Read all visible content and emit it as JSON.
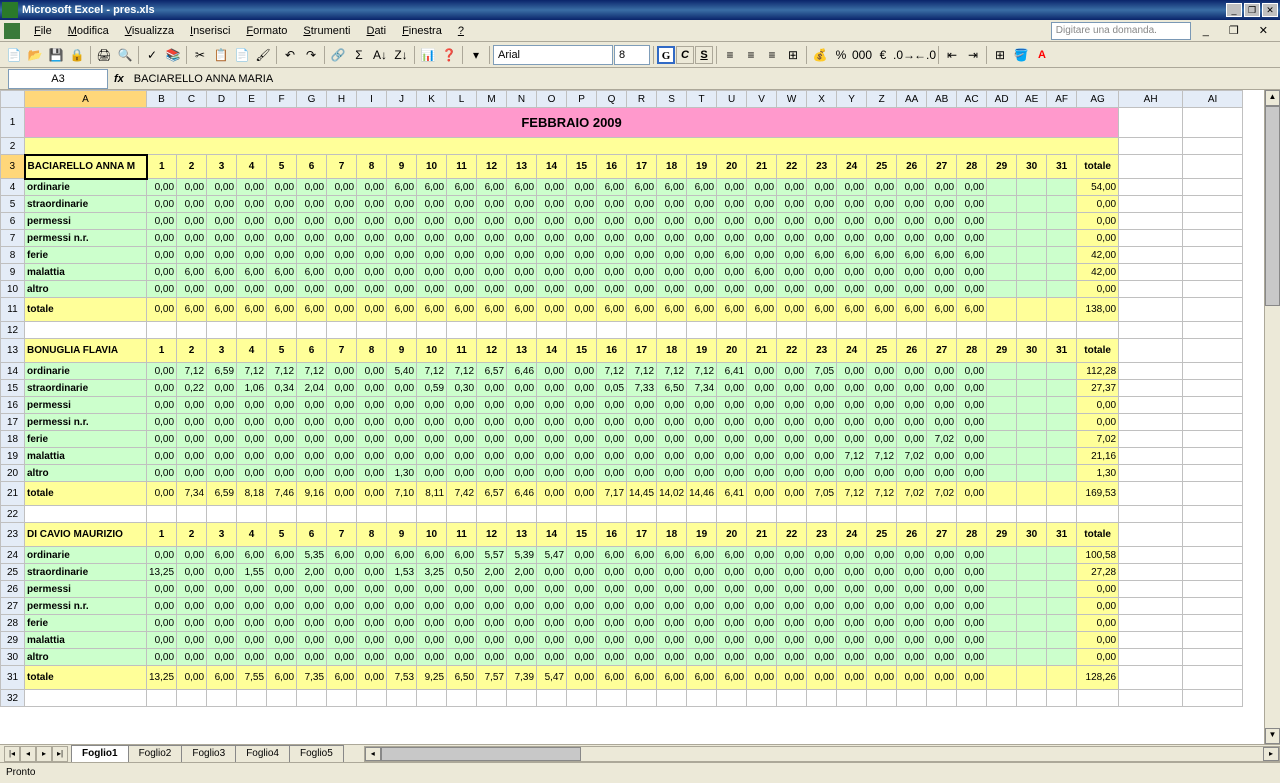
{
  "app": {
    "title": "Microsoft Excel - pres.xls"
  },
  "menu": {
    "items": [
      "File",
      "Modifica",
      "Visualizza",
      "Inserisci",
      "Formato",
      "Strumenti",
      "Dati",
      "Finestra",
      "?"
    ],
    "question": "Digitare una domanda."
  },
  "toolbar": {
    "font": "Arial",
    "size": "8"
  },
  "namebox": {
    "ref": "A3",
    "formula": "BACIARELLO ANNA MARIA"
  },
  "columns": [
    "A",
    "B",
    "C",
    "D",
    "E",
    "F",
    "G",
    "H",
    "I",
    "J",
    "K",
    "L",
    "M",
    "N",
    "O",
    "P",
    "Q",
    "R",
    "S",
    "T",
    "U",
    "V",
    "W",
    "X",
    "Y",
    "Z",
    "AA",
    "AB",
    "AC",
    "AD",
    "AE",
    "AF",
    "AG",
    "AH",
    "AI"
  ],
  "monthTitle": "FEBBRAIO 2009",
  "days": [
    "1",
    "2",
    "3",
    "4",
    "5",
    "6",
    "7",
    "8",
    "9",
    "10",
    "11",
    "12",
    "13",
    "14",
    "15",
    "16",
    "17",
    "18",
    "19",
    "20",
    "21",
    "22",
    "23",
    "24",
    "25",
    "26",
    "27",
    "28",
    "29",
    "30",
    "31"
  ],
  "totLabel": "totale",
  "rowLabels": {
    "ord": "ordinarie",
    "str": "straordinarie",
    "per": "permessi",
    "pnr": "permessi n.r.",
    "fer": "ferie",
    "mal": "malattia",
    "alt": "altro",
    "tot": "totale"
  },
  "chart_data": {
    "type": "table",
    "title": "FEBBRAIO 2009",
    "categories": [
      "1",
      "2",
      "3",
      "4",
      "5",
      "6",
      "7",
      "8",
      "9",
      "10",
      "11",
      "12",
      "13",
      "14",
      "15",
      "16",
      "17",
      "18",
      "19",
      "20",
      "21",
      "22",
      "23",
      "24",
      "25",
      "26",
      "27",
      "28"
    ],
    "persons": [
      {
        "name": "BACIARELLO ANNA M",
        "rows": {
          "ordinarie": {
            "v": [
              "0,00",
              "0,00",
              "0,00",
              "0,00",
              "0,00",
              "0,00",
              "0,00",
              "0,00",
              "6,00",
              "6,00",
              "6,00",
              "6,00",
              "6,00",
              "0,00",
              "0,00",
              "6,00",
              "6,00",
              "6,00",
              "6,00",
              "0,00",
              "0,00",
              "0,00",
              "0,00",
              "0,00",
              "0,00",
              "0,00",
              "0,00",
              "0,00"
            ],
            "t": "54,00"
          },
          "straordinarie": {
            "v": [
              "0,00",
              "0,00",
              "0,00",
              "0,00",
              "0,00",
              "0,00",
              "0,00",
              "0,00",
              "0,00",
              "0,00",
              "0,00",
              "0,00",
              "0,00",
              "0,00",
              "0,00",
              "0,00",
              "0,00",
              "0,00",
              "0,00",
              "0,00",
              "0,00",
              "0,00",
              "0,00",
              "0,00",
              "0,00",
              "0,00",
              "0,00",
              "0,00"
            ],
            "t": "0,00"
          },
          "permessi": {
            "v": [
              "0,00",
              "0,00",
              "0,00",
              "0,00",
              "0,00",
              "0,00",
              "0,00",
              "0,00",
              "0,00",
              "0,00",
              "0,00",
              "0,00",
              "0,00",
              "0,00",
              "0,00",
              "0,00",
              "0,00",
              "0,00",
              "0,00",
              "0,00",
              "0,00",
              "0,00",
              "0,00",
              "0,00",
              "0,00",
              "0,00",
              "0,00",
              "0,00"
            ],
            "t": "0,00"
          },
          "permessi n.r.": {
            "v": [
              "0,00",
              "0,00",
              "0,00",
              "0,00",
              "0,00",
              "0,00",
              "0,00",
              "0,00",
              "0,00",
              "0,00",
              "0,00",
              "0,00",
              "0,00",
              "0,00",
              "0,00",
              "0,00",
              "0,00",
              "0,00",
              "0,00",
              "0,00",
              "0,00",
              "0,00",
              "0,00",
              "0,00",
              "0,00",
              "0,00",
              "0,00",
              "0,00"
            ],
            "t": "0,00"
          },
          "ferie": {
            "v": [
              "0,00",
              "0,00",
              "0,00",
              "0,00",
              "0,00",
              "0,00",
              "0,00",
              "0,00",
              "0,00",
              "0,00",
              "0,00",
              "0,00",
              "0,00",
              "0,00",
              "0,00",
              "0,00",
              "0,00",
              "0,00",
              "0,00",
              "6,00",
              "0,00",
              "0,00",
              "6,00",
              "6,00",
              "6,00",
              "6,00",
              "6,00",
              "6,00"
            ],
            "t": "42,00"
          },
          "malattia": {
            "v": [
              "0,00",
              "6,00",
              "6,00",
              "6,00",
              "6,00",
              "6,00",
              "0,00",
              "0,00",
              "0,00",
              "0,00",
              "0,00",
              "0,00",
              "0,00",
              "0,00",
              "0,00",
              "0,00",
              "0,00",
              "0,00",
              "0,00",
              "0,00",
              "6,00",
              "0,00",
              "0,00",
              "0,00",
              "0,00",
              "0,00",
              "0,00",
              "0,00"
            ],
            "t": "42,00"
          },
          "altro": {
            "v": [
              "0,00",
              "0,00",
              "0,00",
              "0,00",
              "0,00",
              "0,00",
              "0,00",
              "0,00",
              "0,00",
              "0,00",
              "0,00",
              "0,00",
              "0,00",
              "0,00",
              "0,00",
              "0,00",
              "0,00",
              "0,00",
              "0,00",
              "0,00",
              "0,00",
              "0,00",
              "0,00",
              "0,00",
              "0,00",
              "0,00",
              "0,00",
              "0,00"
            ],
            "t": "0,00"
          },
          "totale": {
            "v": [
              "0,00",
              "6,00",
              "6,00",
              "6,00",
              "6,00",
              "6,00",
              "0,00",
              "0,00",
              "6,00",
              "6,00",
              "6,00",
              "6,00",
              "6,00",
              "0,00",
              "0,00",
              "6,00",
              "6,00",
              "6,00",
              "6,00",
              "6,00",
              "6,00",
              "0,00",
              "6,00",
              "6,00",
              "6,00",
              "6,00",
              "6,00",
              "6,00"
            ],
            "t": "138,00"
          }
        }
      },
      {
        "name": "BONUGLIA FLAVIA",
        "rows": {
          "ordinarie": {
            "v": [
              "0,00",
              "7,12",
              "6,59",
              "7,12",
              "7,12",
              "7,12",
              "0,00",
              "0,00",
              "5,40",
              "7,12",
              "7,12",
              "6,57",
              "6,46",
              "0,00",
              "0,00",
              "7,12",
              "7,12",
              "7,12",
              "7,12",
              "6,41",
              "0,00",
              "0,00",
              "7,05",
              "0,00",
              "0,00",
              "0,00",
              "0,00",
              "0,00"
            ],
            "t": "112,28"
          },
          "straordinarie": {
            "v": [
              "0,00",
              "0,22",
              "0,00",
              "1,06",
              "0,34",
              "2,04",
              "0,00",
              "0,00",
              "0,00",
              "0,59",
              "0,30",
              "0,00",
              "0,00",
              "0,00",
              "0,00",
              "0,05",
              "7,33",
              "6,50",
              "7,34",
              "0,00",
              "0,00",
              "0,00",
              "0,00",
              "0,00",
              "0,00",
              "0,00",
              "0,00",
              "0,00"
            ],
            "t": "27,37"
          },
          "permessi": {
            "v": [
              "0,00",
              "0,00",
              "0,00",
              "0,00",
              "0,00",
              "0,00",
              "0,00",
              "0,00",
              "0,00",
              "0,00",
              "0,00",
              "0,00",
              "0,00",
              "0,00",
              "0,00",
              "0,00",
              "0,00",
              "0,00",
              "0,00",
              "0,00",
              "0,00",
              "0,00",
              "0,00",
              "0,00",
              "0,00",
              "0,00",
              "0,00",
              "0,00"
            ],
            "t": "0,00"
          },
          "permessi n.r.": {
            "v": [
              "0,00",
              "0,00",
              "0,00",
              "0,00",
              "0,00",
              "0,00",
              "0,00",
              "0,00",
              "0,00",
              "0,00",
              "0,00",
              "0,00",
              "0,00",
              "0,00",
              "0,00",
              "0,00",
              "0,00",
              "0,00",
              "0,00",
              "0,00",
              "0,00",
              "0,00",
              "0,00",
              "0,00",
              "0,00",
              "0,00",
              "0,00",
              "0,00"
            ],
            "t": "0,00"
          },
          "ferie": {
            "v": [
              "0,00",
              "0,00",
              "0,00",
              "0,00",
              "0,00",
              "0,00",
              "0,00",
              "0,00",
              "0,00",
              "0,00",
              "0,00",
              "0,00",
              "0,00",
              "0,00",
              "0,00",
              "0,00",
              "0,00",
              "0,00",
              "0,00",
              "0,00",
              "0,00",
              "0,00",
              "0,00",
              "0,00",
              "0,00",
              "0,00",
              "7,02",
              "0,00"
            ],
            "t": "7,02"
          },
          "malattia": {
            "v": [
              "0,00",
              "0,00",
              "0,00",
              "0,00",
              "0,00",
              "0,00",
              "0,00",
              "0,00",
              "0,00",
              "0,00",
              "0,00",
              "0,00",
              "0,00",
              "0,00",
              "0,00",
              "0,00",
              "0,00",
              "0,00",
              "0,00",
              "0,00",
              "0,00",
              "0,00",
              "0,00",
              "7,12",
              "7,12",
              "7,02",
              "0,00",
              "0,00"
            ],
            "t": "21,16"
          },
          "altro": {
            "v": [
              "0,00",
              "0,00",
              "0,00",
              "0,00",
              "0,00",
              "0,00",
              "0,00",
              "0,00",
              "1,30",
              "0,00",
              "0,00",
              "0,00",
              "0,00",
              "0,00",
              "0,00",
              "0,00",
              "0,00",
              "0,00",
              "0,00",
              "0,00",
              "0,00",
              "0,00",
              "0,00",
              "0,00",
              "0,00",
              "0,00",
              "0,00",
              "0,00"
            ],
            "t": "1,30"
          },
          "totale": {
            "v": [
              "0,00",
              "7,34",
              "6,59",
              "8,18",
              "7,46",
              "9,16",
              "0,00",
              "0,00",
              "7,10",
              "8,11",
              "7,42",
              "6,57",
              "6,46",
              "0,00",
              "0,00",
              "7,17",
              "14,45",
              "14,02",
              "14,46",
              "6,41",
              "0,00",
              "0,00",
              "7,05",
              "7,12",
              "7,12",
              "7,02",
              "7,02",
              "0,00"
            ],
            "t": "169,53"
          }
        }
      },
      {
        "name": "DI CAVIO MAURIZIO",
        "rows": {
          "ordinarie": {
            "v": [
              "0,00",
              "0,00",
              "6,00",
              "6,00",
              "6,00",
              "5,35",
              "6,00",
              "0,00",
              "6,00",
              "6,00",
              "6,00",
              "5,57",
              "5,39",
              "5,47",
              "0,00",
              "6,00",
              "6,00",
              "6,00",
              "6,00",
              "6,00",
              "0,00",
              "0,00",
              "0,00",
              "0,00",
              "0,00",
              "0,00",
              "0,00",
              "0,00"
            ],
            "t": "100,58"
          },
          "straordinarie": {
            "v": [
              "13,25",
              "0,00",
              "0,00",
              "1,55",
              "0,00",
              "2,00",
              "0,00",
              "0,00",
              "1,53",
              "3,25",
              "0,50",
              "2,00",
              "2,00",
              "0,00",
              "0,00",
              "0,00",
              "0,00",
              "0,00",
              "0,00",
              "0,00",
              "0,00",
              "0,00",
              "0,00",
              "0,00",
              "0,00",
              "0,00",
              "0,00",
              "0,00"
            ],
            "t": "27,28"
          },
          "permessi": {
            "v": [
              "0,00",
              "0,00",
              "0,00",
              "0,00",
              "0,00",
              "0,00",
              "0,00",
              "0,00",
              "0,00",
              "0,00",
              "0,00",
              "0,00",
              "0,00",
              "0,00",
              "0,00",
              "0,00",
              "0,00",
              "0,00",
              "0,00",
              "0,00",
              "0,00",
              "0,00",
              "0,00",
              "0,00",
              "0,00",
              "0,00",
              "0,00",
              "0,00"
            ],
            "t": "0,00"
          },
          "permessi n.r.": {
            "v": [
              "0,00",
              "0,00",
              "0,00",
              "0,00",
              "0,00",
              "0,00",
              "0,00",
              "0,00",
              "0,00",
              "0,00",
              "0,00",
              "0,00",
              "0,00",
              "0,00",
              "0,00",
              "0,00",
              "0,00",
              "0,00",
              "0,00",
              "0,00",
              "0,00",
              "0,00",
              "0,00",
              "0,00",
              "0,00",
              "0,00",
              "0,00",
              "0,00"
            ],
            "t": "0,00"
          },
          "ferie": {
            "v": [
              "0,00",
              "0,00",
              "0,00",
              "0,00",
              "0,00",
              "0,00",
              "0,00",
              "0,00",
              "0,00",
              "0,00",
              "0,00",
              "0,00",
              "0,00",
              "0,00",
              "0,00",
              "0,00",
              "0,00",
              "0,00",
              "0,00",
              "0,00",
              "0,00",
              "0,00",
              "0,00",
              "0,00",
              "0,00",
              "0,00",
              "0,00",
              "0,00"
            ],
            "t": "0,00"
          },
          "malattia": {
            "v": [
              "0,00",
              "0,00",
              "0,00",
              "0,00",
              "0,00",
              "0,00",
              "0,00",
              "0,00",
              "0,00",
              "0,00",
              "0,00",
              "0,00",
              "0,00",
              "0,00",
              "0,00",
              "0,00",
              "0,00",
              "0,00",
              "0,00",
              "0,00",
              "0,00",
              "0,00",
              "0,00",
              "0,00",
              "0,00",
              "0,00",
              "0,00",
              "0,00"
            ],
            "t": "0,00"
          },
          "altro": {
            "v": [
              "0,00",
              "0,00",
              "0,00",
              "0,00",
              "0,00",
              "0,00",
              "0,00",
              "0,00",
              "0,00",
              "0,00",
              "0,00",
              "0,00",
              "0,00",
              "0,00",
              "0,00",
              "0,00",
              "0,00",
              "0,00",
              "0,00",
              "0,00",
              "0,00",
              "0,00",
              "0,00",
              "0,00",
              "0,00",
              "0,00",
              "0,00",
              "0,00"
            ],
            "t": "0,00"
          },
          "totale": {
            "v": [
              "13,25",
              "0,00",
              "6,00",
              "7,55",
              "6,00",
              "7,35",
              "6,00",
              "0,00",
              "7,53",
              "9,25",
              "6,50",
              "7,57",
              "7,39",
              "5,47",
              "0,00",
              "6,00",
              "6,00",
              "6,00",
              "6,00",
              "6,00",
              "0,00",
              "0,00",
              "0,00",
              "0,00",
              "0,00",
              "0,00",
              "0,00",
              "0,00"
            ],
            "t": "128,26"
          }
        }
      }
    ]
  },
  "tabs": {
    "sheets": [
      "Foglio1",
      "Foglio2",
      "Foglio3",
      "Foglio4",
      "Foglio5"
    ],
    "active": 0
  },
  "status": "Pronto"
}
